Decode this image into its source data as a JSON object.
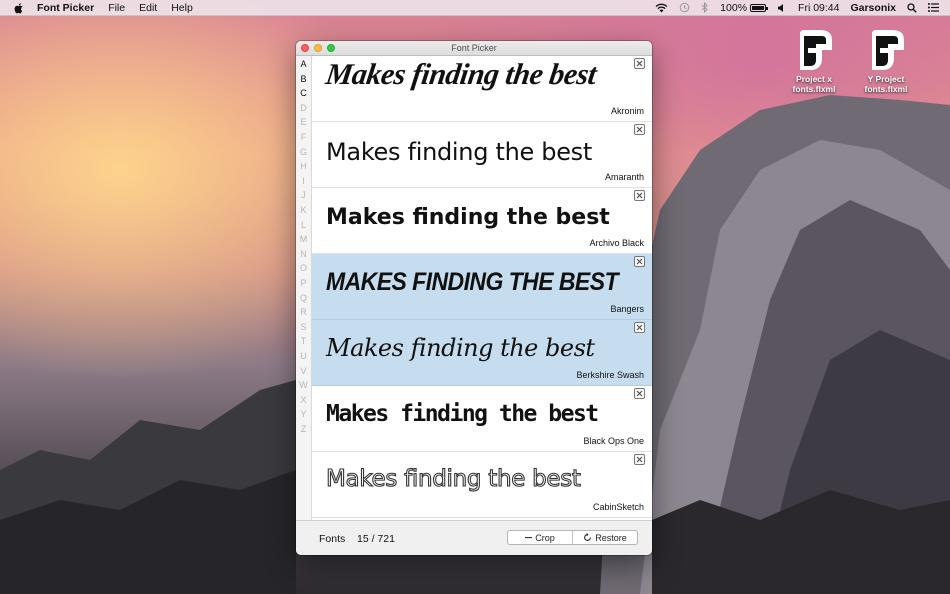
{
  "menubar": {
    "app_name": "Font Picker",
    "menus": [
      "File",
      "Edit",
      "Help"
    ],
    "battery": "100%",
    "clock": "Fri 09:44",
    "user": "Garsonix"
  },
  "desktop_icons": [
    {
      "label": "Project x fonts.flxml"
    },
    {
      "label": "Y Project fonts.flxml"
    }
  ],
  "window": {
    "title": "Font Picker",
    "alphabet": [
      "A",
      "B",
      "C",
      "D",
      "E",
      "F",
      "G",
      "H",
      "I",
      "J",
      "K",
      "L",
      "M",
      "N",
      "O",
      "P",
      "Q",
      "R",
      "S",
      "T",
      "U",
      "V",
      "W",
      "X",
      "Y",
      "Z"
    ],
    "active_letters": [
      "A",
      "B",
      "C"
    ],
    "fonts": [
      {
        "name": "Akronim",
        "sample": "Makes finding the best",
        "selected": false
      },
      {
        "name": "Amaranth",
        "sample": "Makes finding the best",
        "selected": false
      },
      {
        "name": "Archivo Black",
        "sample": "Makes finding the best",
        "selected": false
      },
      {
        "name": "Bangers",
        "sample": "MAKES FINDING THE BEST",
        "selected": true
      },
      {
        "name": "Berkshire Swash",
        "sample": "Makes finding the best",
        "selected": true
      },
      {
        "name": "Black Ops One",
        "sample": "Makes finding the best",
        "selected": false
      },
      {
        "name": "CabinSketch",
        "sample": "Makes finding the best",
        "selected": false
      }
    ],
    "footer": {
      "label": "Fonts",
      "count": "15 / 721",
      "crop_label": "Crop",
      "restore_label": "Restore"
    }
  }
}
